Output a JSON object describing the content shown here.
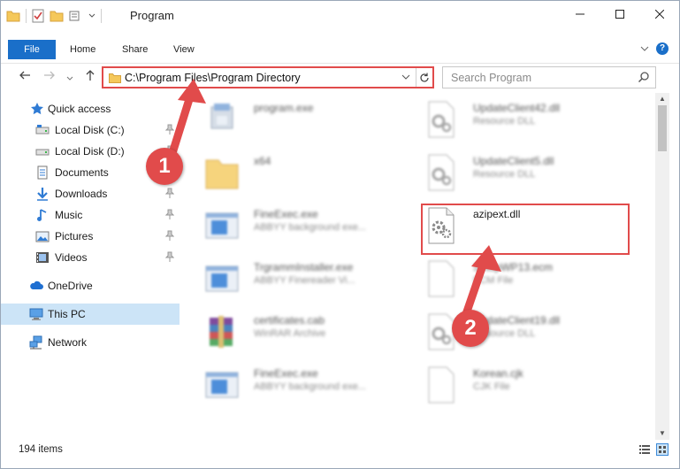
{
  "window": {
    "title": "Program"
  },
  "ribbon": {
    "tabs": [
      "File",
      "Home",
      "Share",
      "View"
    ]
  },
  "address": {
    "path": "C:\\Program Files\\Program Directory"
  },
  "search": {
    "placeholder": "Search Program"
  },
  "sidebar": {
    "items": [
      {
        "label": "Quick access",
        "icon": "star-icon"
      },
      {
        "label": "Local Disk (C:)",
        "icon": "drive-icon",
        "pinned": true
      },
      {
        "label": "Local Disk (D:)",
        "icon": "drive-icon",
        "pinned": true
      },
      {
        "label": "Documents",
        "icon": "documents-icon",
        "pinned": true
      },
      {
        "label": "Downloads",
        "icon": "download-icon",
        "pinned": true
      },
      {
        "label": "Music",
        "icon": "music-icon",
        "pinned": true
      },
      {
        "label": "Pictures",
        "icon": "pictures-icon",
        "pinned": true
      },
      {
        "label": "Videos",
        "icon": "videos-icon",
        "pinned": true
      },
      {
        "label": "OneDrive",
        "icon": "cloud-icon"
      },
      {
        "label": "This PC",
        "icon": "pc-icon",
        "selected": true
      },
      {
        "label": "Network",
        "icon": "network-icon"
      }
    ]
  },
  "files": [
    {
      "name": "program.exe",
      "desc": "",
      "icon": "exe-icon"
    },
    {
      "name": "UpdateClient42.dll",
      "desc": "Resource DLL",
      "icon": "dll-icon"
    },
    {
      "name": "x64",
      "desc": "",
      "icon": "folder-icon"
    },
    {
      "name": "UpdateClient5.dll",
      "desc": "Resource DLL",
      "icon": "dll-icon"
    },
    {
      "name": "FineExec.exe",
      "desc": "ABBYY background exe...",
      "icon": "window-icon"
    },
    {
      "name": "azipext.dll",
      "desc": "",
      "icon": "dll-icon"
    },
    {
      "name": "TrgrammInstaller.exe",
      "desc": "ABBYY Finereader Vi...",
      "icon": "window-icon"
    },
    {
      "name": "SetupWP13.ecm",
      "desc": "ECM File",
      "icon": "file-icon"
    },
    {
      "name": "certificates.cab",
      "desc": "WinRAR Archive",
      "icon": "archive-icon"
    },
    {
      "name": "UpdateClient19.dll",
      "desc": "Resource DLL",
      "icon": "dll-icon"
    },
    {
      "name": "FineExec.exe",
      "desc": "ABBYY background exe...",
      "icon": "window-icon"
    },
    {
      "name": "Korean.cjk",
      "desc": "CJK File",
      "icon": "file-icon"
    }
  ],
  "status": {
    "count": "194 items"
  },
  "annotations": {
    "badge1": "1",
    "badge2": "2"
  },
  "colors": {
    "accent": "#1a6fc9",
    "highlight": "#e14b4b",
    "selected": "#cce4f7"
  }
}
